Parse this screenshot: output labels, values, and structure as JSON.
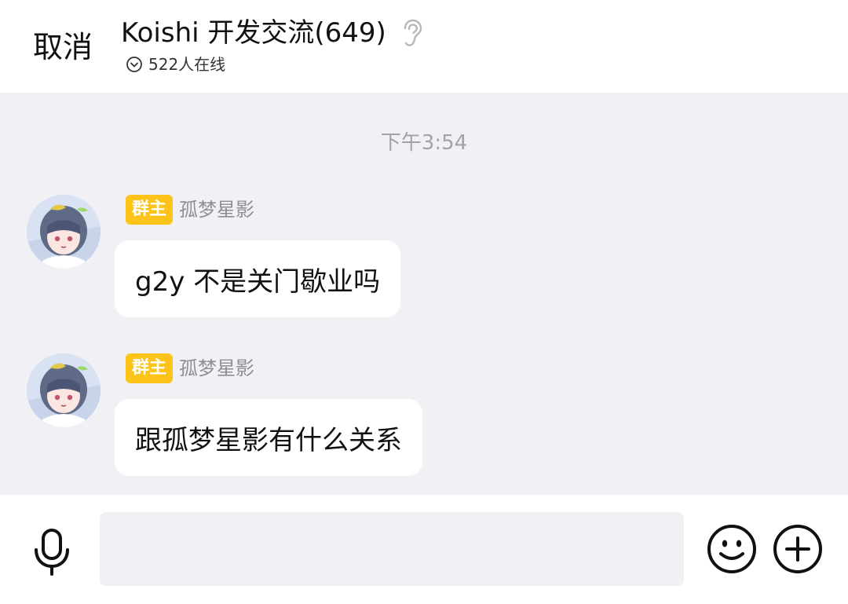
{
  "header": {
    "cancel_label": "取消",
    "title": "Koishi 开发交流(649)",
    "ear_icon": "ear-icon",
    "online_icon": "chevron-down-circle-icon",
    "online_text": "522人在线"
  },
  "chat": {
    "timestamp": "下午3:54",
    "messages": [
      {
        "badge": "群主",
        "sender": "孤梦星影",
        "text": "g2y 不是关门歇业吗"
      },
      {
        "badge": "群主",
        "sender": "孤梦星影",
        "text": "跟孤梦星影有什么关系"
      }
    ]
  },
  "input_bar": {
    "mic_icon": "microphone-icon",
    "placeholder": "",
    "value": "",
    "emoji_icon": "smiley-icon",
    "plus_icon": "plus-circle-icon"
  },
  "colors": {
    "badge_bg": "#fcc419",
    "chat_bg": "#f1f0f4",
    "bubble_bg": "#ffffff",
    "timestamp": "#a2a2a8",
    "sender": "#8e8e93"
  }
}
